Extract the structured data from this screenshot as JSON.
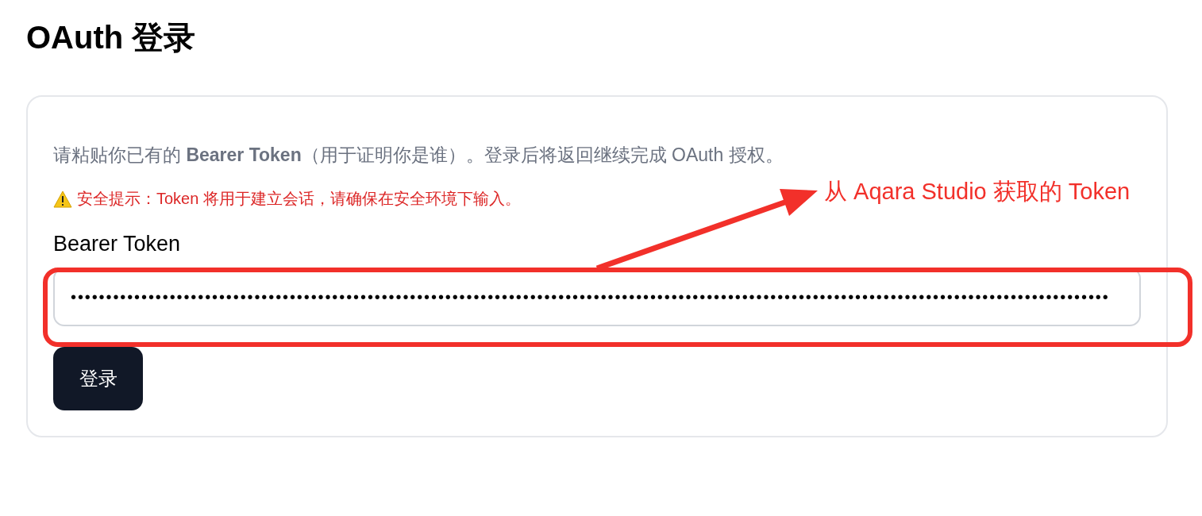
{
  "title": "OAuth 登录",
  "intro": "请粘贴你已有的 **Bearer Token**（用于证明你是谁）。登录后将返回继续完成 OAuth 授权。",
  "warning": "安全提示：Token 将用于建立会话，请确保在安全环境下输入。",
  "field": {
    "label": "Bearer Token",
    "value": "•••••••••••••••••••••••••••••••••••••••••••••••••••••••••••••••••••••••••••••••••••••••••••••••••••••••••••••••••••••••••••••••••••••••••••••••••••"
  },
  "button": "登录",
  "annotation": {
    "text": "从 Aqara Studio 获取的 Token"
  }
}
